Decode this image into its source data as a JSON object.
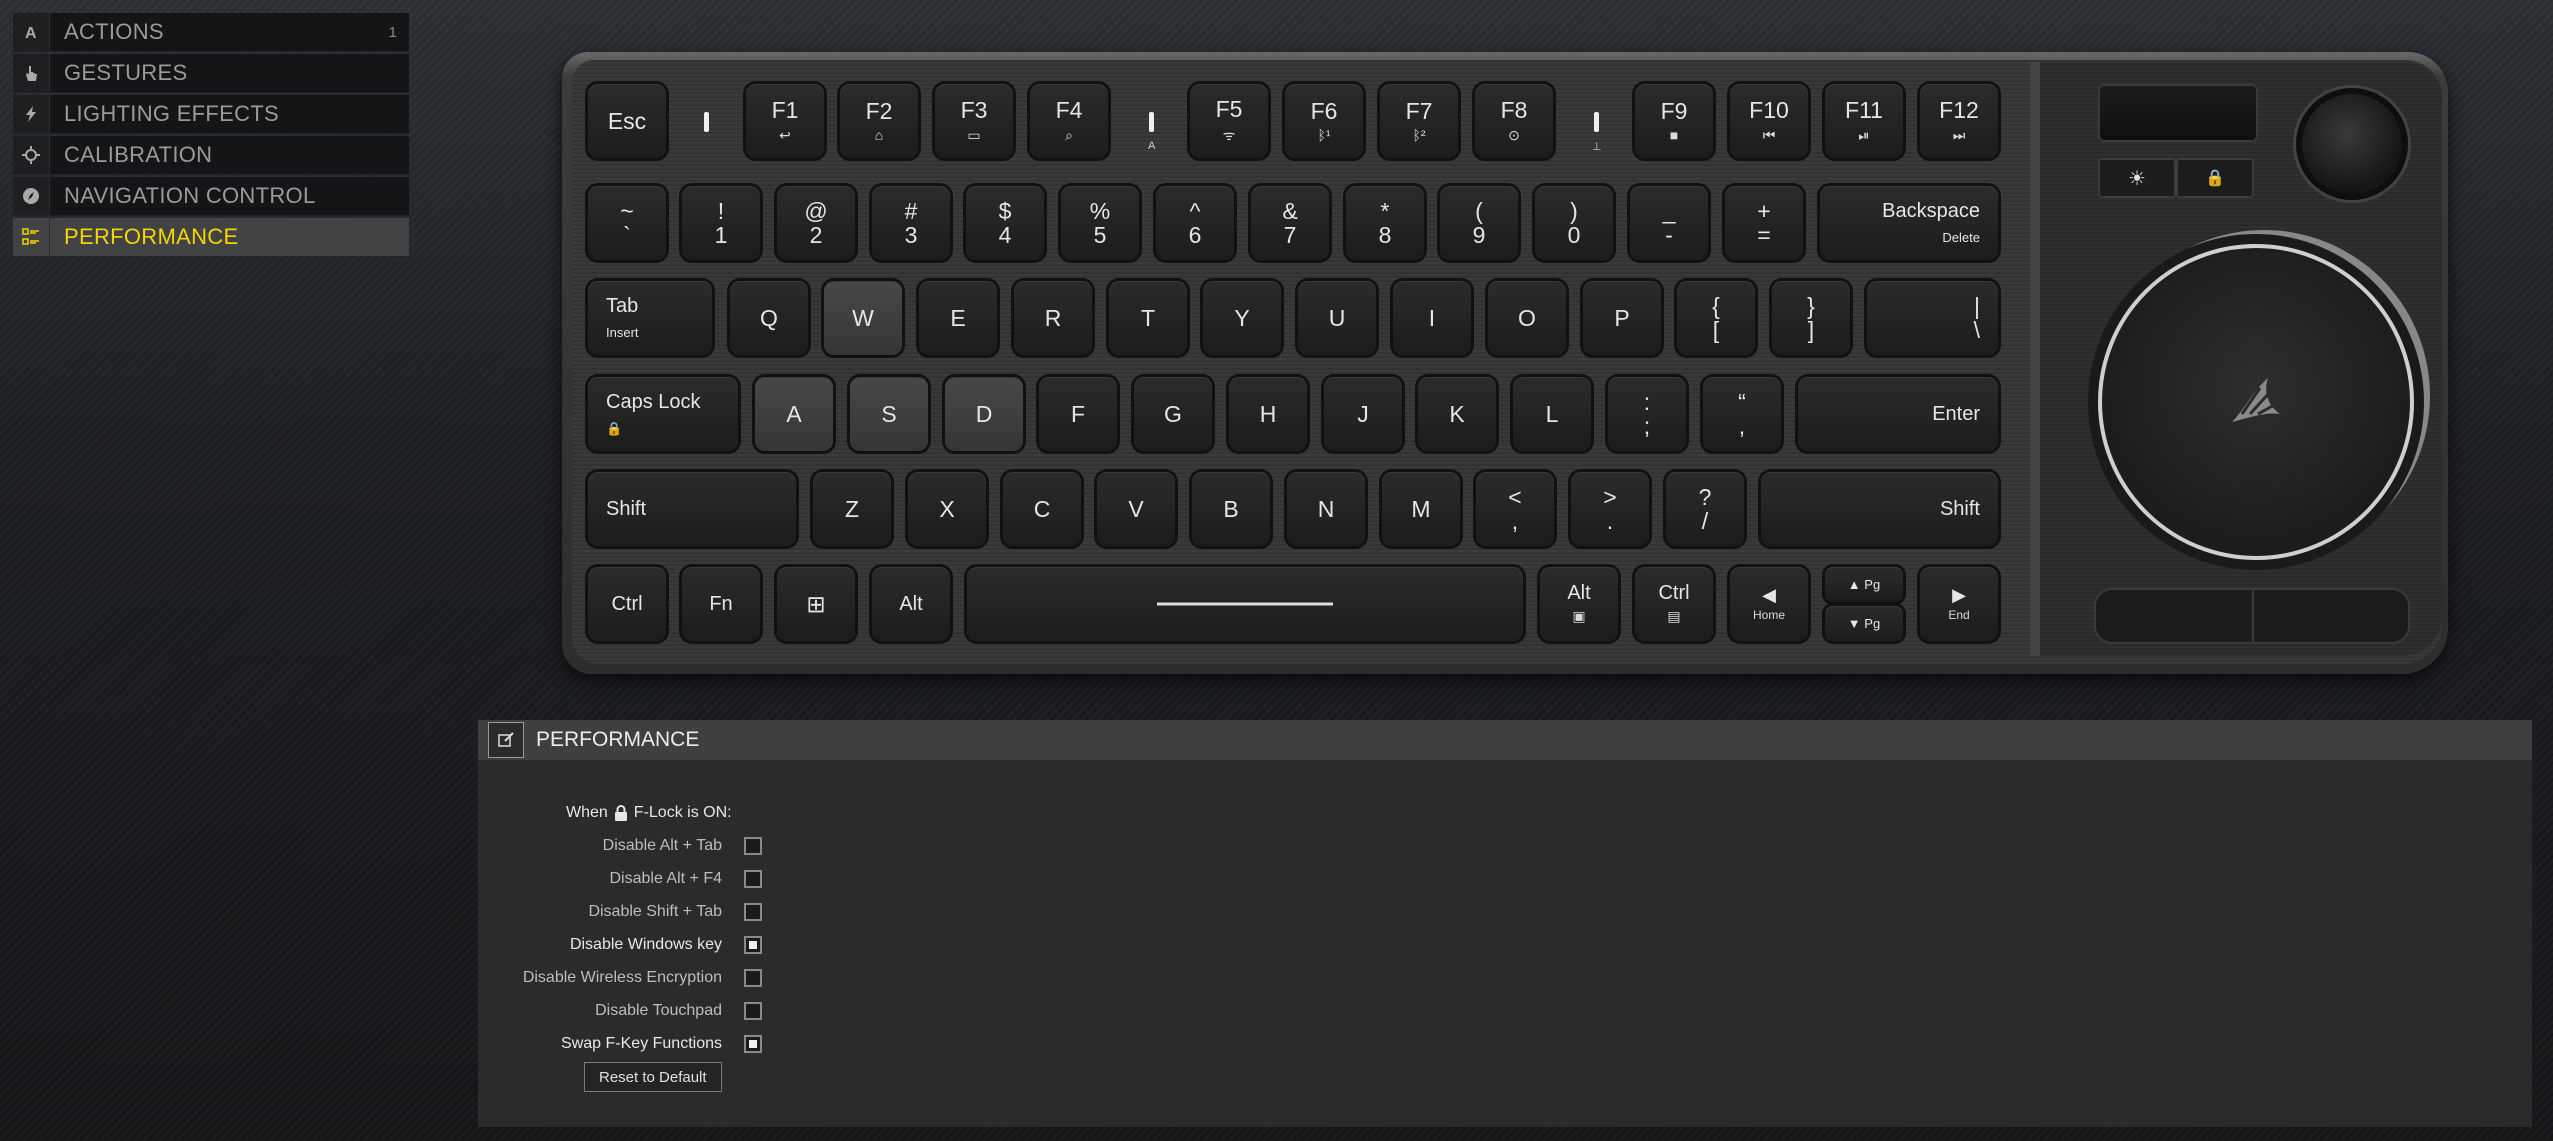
{
  "sidebar": {
    "items": [
      {
        "label": "ACTIONS",
        "count": "1",
        "icon": "actions-icon"
      },
      {
        "label": "GESTURES",
        "icon": "hand-icon"
      },
      {
        "label": "LIGHTING EFFECTS",
        "icon": "lightning-icon"
      },
      {
        "label": "CALIBRATION",
        "icon": "crosshair-icon"
      },
      {
        "label": "NAVIGATION CONTROL",
        "icon": "compass-icon"
      },
      {
        "label": "PERFORMANCE",
        "icon": "performance-icon",
        "active": true
      }
    ],
    "accent_color": "#f5d400"
  },
  "keyboard": {
    "fn_row": [
      {
        "main": "Esc"
      },
      {
        "main": "F1",
        "sub": "↩"
      },
      {
        "main": "F2",
        "sub": "⌂"
      },
      {
        "main": "F3",
        "sub": "▭"
      },
      {
        "main": "F4",
        "sub": "⌕"
      },
      {
        "main": "F5",
        "sub": "ᯤ"
      },
      {
        "main": "F6",
        "sub": "ᛒ¹"
      },
      {
        "main": "F7",
        "sub": "ᛒ²"
      },
      {
        "main": "F8",
        "sub": "⊙"
      },
      {
        "main": "F9",
        "sub": "■"
      },
      {
        "main": "F10",
        "sub": "⏮"
      },
      {
        "main": "F11",
        "sub": "⏯"
      },
      {
        "main": "F12",
        "sub": "⏭"
      }
    ],
    "indicator_labels": [
      "A",
      "⊥"
    ],
    "num_row": [
      {
        "top": "~",
        "bot": "`"
      },
      {
        "top": "!",
        "bot": "1"
      },
      {
        "top": "@",
        "bot": "2"
      },
      {
        "top": "#",
        "bot": "3"
      },
      {
        "top": "$",
        "bot": "4"
      },
      {
        "top": "%",
        "bot": "5"
      },
      {
        "top": "^",
        "bot": "6"
      },
      {
        "top": "&",
        "bot": "7"
      },
      {
        "top": "*",
        "bot": "8"
      },
      {
        "top": "(",
        "bot": "9"
      },
      {
        "top": ")",
        "bot": "0"
      },
      {
        "top": "_",
        "bot": "-"
      },
      {
        "top": "+",
        "bot": "="
      },
      {
        "top": "Backspace",
        "bot": "Delete"
      }
    ],
    "tab_row": [
      {
        "top": "Tab",
        "bot": "Insert"
      },
      {
        "top": "Q"
      },
      {
        "top": "W"
      },
      {
        "top": "E"
      },
      {
        "top": "R"
      },
      {
        "top": "T"
      },
      {
        "top": "Y"
      },
      {
        "top": "U"
      },
      {
        "top": "I"
      },
      {
        "top": "O"
      },
      {
        "top": "P"
      },
      {
        "top": "{",
        "bot": "["
      },
      {
        "top": "}",
        "bot": "]"
      },
      {
        "top": "|",
        "bot": "\\"
      }
    ],
    "caps_row": [
      {
        "top": "Caps Lock",
        "bot": "🔒"
      },
      {
        "top": "A"
      },
      {
        "top": "S"
      },
      {
        "top": "D"
      },
      {
        "top": "F"
      },
      {
        "top": "G"
      },
      {
        "top": "H"
      },
      {
        "top": "J"
      },
      {
        "top": "K"
      },
      {
        "top": "L"
      },
      {
        "top": ":",
        "bot": ";"
      },
      {
        "top": "“",
        "bot": ","
      },
      {
        "top": "Enter"
      }
    ],
    "shift_row": [
      {
        "top": "Shift"
      },
      {
        "top": "Z"
      },
      {
        "top": "X"
      },
      {
        "top": "C"
      },
      {
        "top": "V"
      },
      {
        "top": "B"
      },
      {
        "top": "N"
      },
      {
        "top": "M"
      },
      {
        "top": "<",
        "bot": ","
      },
      {
        "top": ">",
        "bot": "."
      },
      {
        "top": "?",
        "bot": "/"
      },
      {
        "top": "Shift"
      }
    ],
    "bottom_row": [
      {
        "top": "Ctrl"
      },
      {
        "top": "Fn"
      },
      {
        "top": "⊞"
      },
      {
        "top": "Alt"
      },
      {
        "top": ""
      },
      {
        "top": "Alt",
        "bot": "▣"
      },
      {
        "top": "Ctrl",
        "bot": "▤"
      },
      {
        "top": "◀",
        "bot": "Home"
      },
      {
        "top": "▲ Pg",
        "bot": "▼ Pg"
      },
      {
        "top": "▶",
        "bot": "End"
      }
    ],
    "side_buttons": [
      "☀",
      "🔒"
    ]
  },
  "panel": {
    "title": "PERFORMANCE",
    "when_prefix": "When",
    "when_suffix": "F-Lock is ON:",
    "options": [
      {
        "label": "Disable Alt + Tab",
        "checked": false
      },
      {
        "label": "Disable Alt + F4",
        "checked": false
      },
      {
        "label": "Disable Shift + Tab",
        "checked": false
      },
      {
        "label": "Disable Windows key",
        "checked": true
      },
      {
        "label": "Disable Wireless Encryption",
        "checked": false
      },
      {
        "label": "Disable Touchpad",
        "checked": false
      },
      {
        "label": "Swap F-Key Functions",
        "checked": true
      }
    ],
    "reset_label": "Reset to Default"
  }
}
